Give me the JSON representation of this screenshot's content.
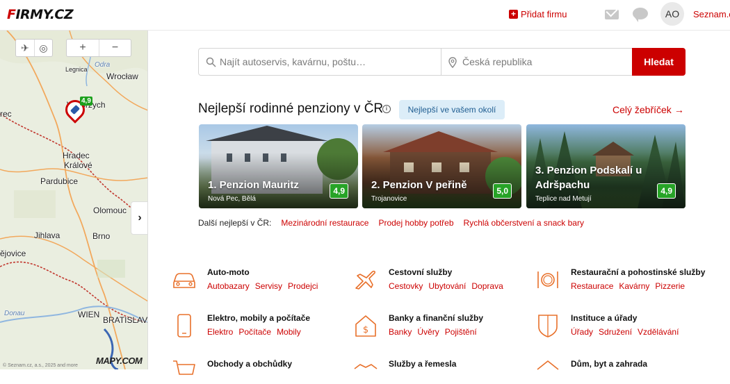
{
  "header": {
    "logo": "Firmy.cz",
    "add_firm": "Přidat firmu",
    "avatar_initials": "AO",
    "seznam_link": "Seznam.cz"
  },
  "map": {
    "labels": {
      "legnica": "Legnica",
      "odra": "Odra",
      "wroclaw": "Wrocław",
      "walbrzych": "Wałbrzych",
      "rec": "rec",
      "hradec": "Hradec",
      "kralove": "Králové",
      "pardubice": "Pardubice",
      "olomouc": "Olomouc",
      "brno": "Brno",
      "jihlava": "Jihlava",
      "jejovice": "ějovice",
      "donau": "Donau",
      "wien": "WIEN",
      "bratislava": "BRATISLAVA"
    },
    "pin_rating": "4,9",
    "brand": "MAPY.COM",
    "copyright": "© Seznam.cz, a.s., 2025 and more"
  },
  "search": {
    "what_placeholder": "Najít autoservis, kavárnu, poštu…",
    "where_placeholder": "Česká republika",
    "button": "Hledat"
  },
  "best": {
    "title": "Nejlepší rodinné penziony v ČR",
    "nearby": "Nejlepší ve vašem okolí",
    "full_ranking": "Celý žebříček",
    "cards": [
      {
        "name": "1. Penzion Mauritz",
        "location": "Nová Pec, Bělá",
        "rating": "4,9"
      },
      {
        "name": "2. Penzion V peřině",
        "location": "Trojanovice",
        "rating": "5,0"
      },
      {
        "name": "3. Penzion Podskalí u Adršpachu",
        "location": "Teplice nad Metují",
        "rating": "4,9"
      }
    ],
    "more_label": "Další nejlepší v ČR:",
    "more_links": [
      "Mezinárodní restaurace",
      "Prodej hobby potřeb",
      "Rychlá občerstvení a snack bary"
    ]
  },
  "categories": [
    {
      "title": "Auto-moto",
      "links": [
        "Autobazary",
        "Servisy",
        "Prodejci"
      ],
      "icon": "car-icon"
    },
    {
      "title": "Cestovní služby",
      "links": [
        "Cestovky",
        "Ubytování",
        "Doprava"
      ],
      "icon": "plane-icon"
    },
    {
      "title": "Restaurační a pohostinské služby",
      "links": [
        "Restaurace",
        "Kavárny",
        "Pizzerie"
      ],
      "icon": "plate-icon"
    },
    {
      "title": "Elektro, mobily a počítače",
      "links": [
        "Elektro",
        "Počítače",
        "Mobily"
      ],
      "icon": "phone-icon"
    },
    {
      "title": "Banky a finanční služby",
      "links": [
        "Banky",
        "Úvěry",
        "Pojištění"
      ],
      "icon": "bank-icon"
    },
    {
      "title": "Instituce a úřady",
      "links": [
        "Úřady",
        "Sdružení",
        "Vzdělávání"
      ],
      "icon": "shield-icon"
    },
    {
      "title": "Obchody a obchůdky",
      "links": [],
      "icon": "cart-icon"
    },
    {
      "title": "Služby a řemesla",
      "links": [],
      "icon": "handshake-icon"
    },
    {
      "title": "Dům, byt a zahrada",
      "links": [],
      "icon": "house-icon"
    }
  ],
  "colors": {
    "accent": "#cc0000",
    "rating_green": "#27a327",
    "nearby_bg": "#dcedf8"
  }
}
